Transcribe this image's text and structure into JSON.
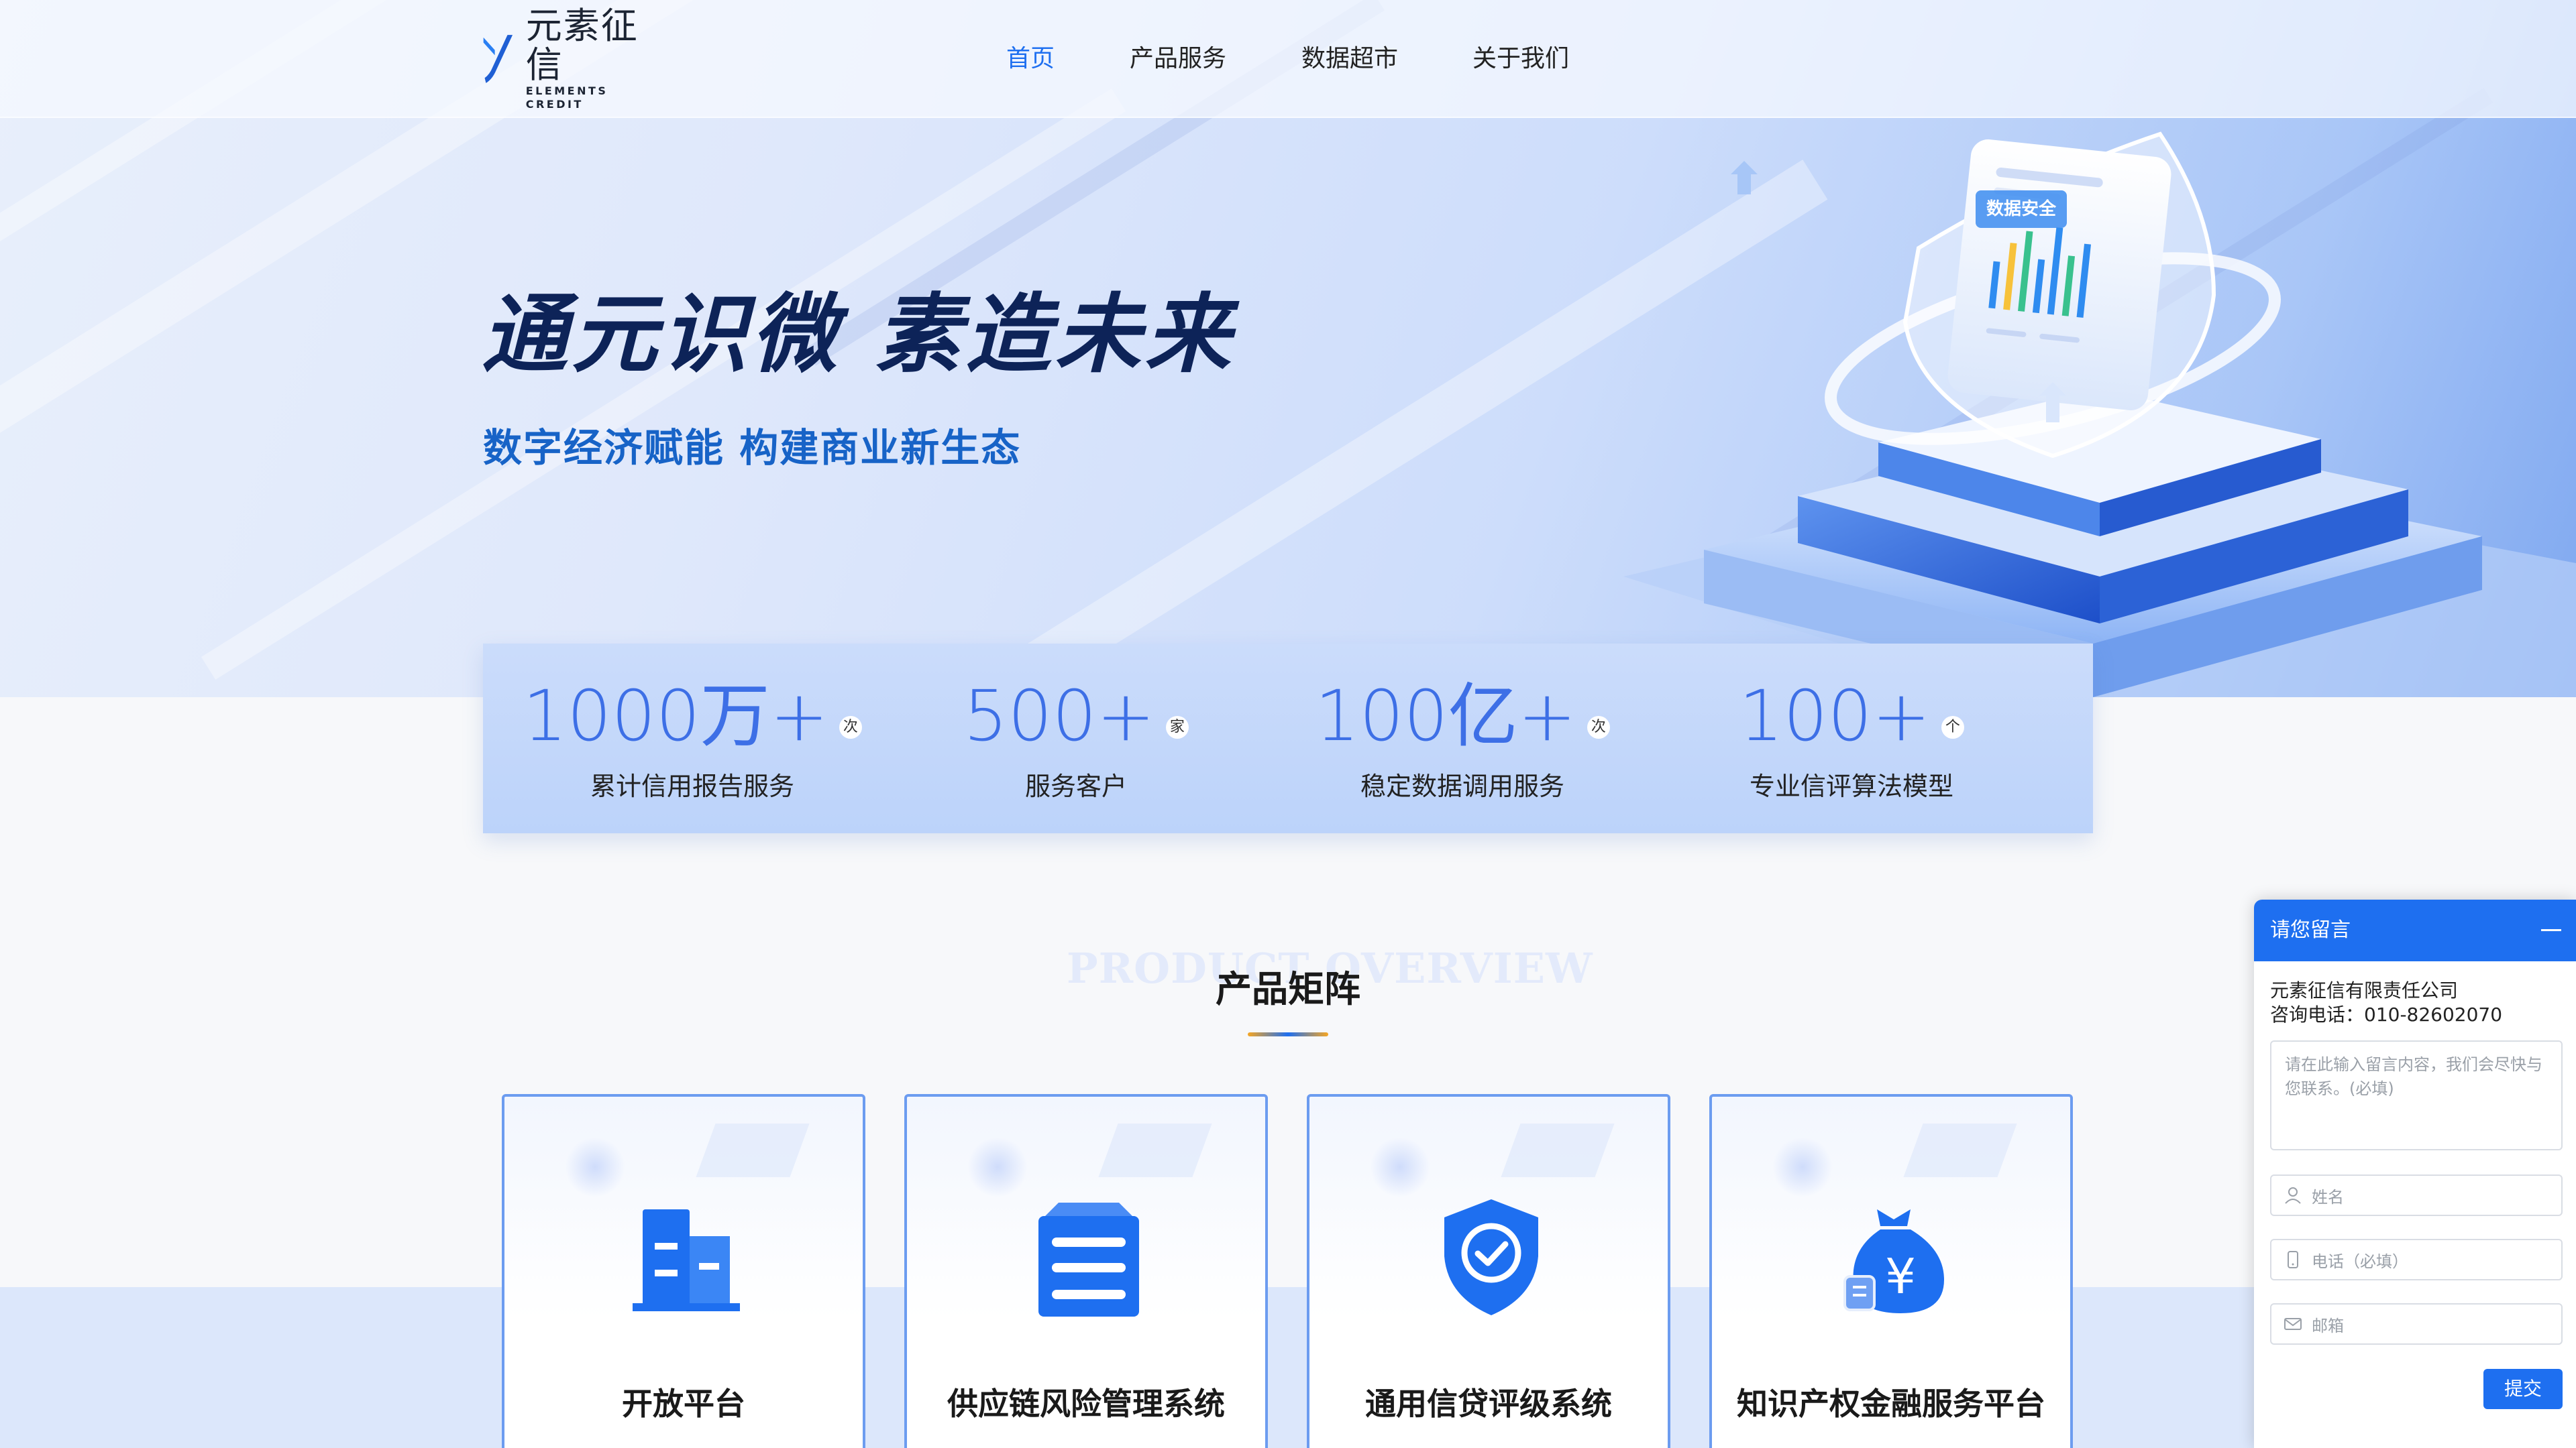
{
  "logo": {
    "cn": "元素征信",
    "en": "ELEMENTS CREDIT"
  },
  "nav": {
    "items": [
      {
        "label": "首页",
        "active": true
      },
      {
        "label": "产品服务",
        "active": false
      },
      {
        "label": "数据超市",
        "active": false
      },
      {
        "label": "关于我们",
        "active": false
      }
    ]
  },
  "hero": {
    "title": "通元识微  素造未来",
    "subtitle": "数字经济赋能 构建商业新生态",
    "badge": "数据安全"
  },
  "stats": [
    {
      "value": "1000万+",
      "unit": "次",
      "label": "累计信用报告服务"
    },
    {
      "value": "500+",
      "unit": "家",
      "label": "服务客户"
    },
    {
      "value": "100亿+",
      "unit": "次",
      "label": "稳定数据调用服务"
    },
    {
      "value": "100+",
      "unit": "个",
      "label": "专业信评算法模型"
    }
  ],
  "products": {
    "overview_en": "PRODUCT OVERVIEW",
    "title": "产品矩阵",
    "cards": [
      {
        "label": "开放平台",
        "icon": "building-icon"
      },
      {
        "label": "供应链风险管理系统",
        "icon": "server-stack-icon"
      },
      {
        "label": "通用信贷评级系统",
        "icon": "shield-check-icon"
      },
      {
        "label": "知识产权金融服务平台",
        "icon": "money-bag-icon"
      }
    ]
  },
  "chat": {
    "header": "请您留言",
    "company": "元素征信有限责任公司",
    "phone": "咨询电话：010-82602070",
    "textarea_placeholder": "请在此输入留言内容，我们会尽快与您联系。(必填)",
    "name_placeholder": "姓名",
    "phone_placeholder": "电话（必填）",
    "email_placeholder": "邮箱",
    "submit": "提交"
  },
  "colors": {
    "brand": "#1e6ff0",
    "hero_title": "#0d2358",
    "hero_subtitle": "#1763c7",
    "stat_number": "#3d6fe6",
    "card_border": "#6c9cf0"
  }
}
